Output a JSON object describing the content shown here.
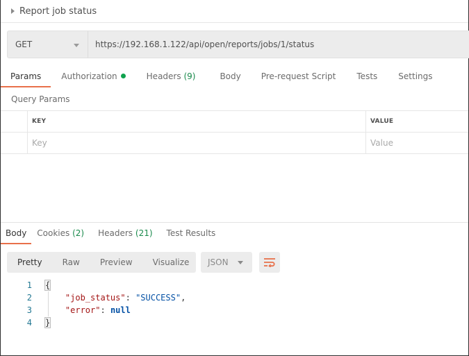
{
  "request": {
    "title": "Report job status",
    "method": "GET",
    "url": "https://192.168.1.122/api/open/reports/jobs/1/status"
  },
  "request_tabs": [
    {
      "label": "Params",
      "active": true
    },
    {
      "label": "Authorization",
      "indicator": "green-dot"
    },
    {
      "label": "Headers",
      "count": "(9)"
    },
    {
      "label": "Body"
    },
    {
      "label": "Pre-request Script"
    },
    {
      "label": "Tests"
    },
    {
      "label": "Settings"
    }
  ],
  "params": {
    "section_label": "Query Params",
    "columns": {
      "key": "KEY",
      "value": "VALUE"
    },
    "placeholders": {
      "key": "Key",
      "value": "Value"
    }
  },
  "response_tabs": [
    {
      "label": "Body",
      "active": true
    },
    {
      "label": "Cookies",
      "count": "(2)"
    },
    {
      "label": "Headers",
      "count": "(21)"
    },
    {
      "label": "Test Results"
    }
  ],
  "view_modes": [
    {
      "label": "Pretty",
      "active": true
    },
    {
      "label": "Raw"
    },
    {
      "label": "Preview"
    },
    {
      "label": "Visualize"
    }
  ],
  "format": {
    "selected": "JSON"
  },
  "icons": {
    "wrap": "wrap-lines-icon",
    "expand": "caret-right-icon",
    "dropdown": "chevron-down-icon"
  },
  "colors": {
    "accent": "#e8704a",
    "success": "#0fa24e",
    "count": "#1a8a4c"
  },
  "response_body": {
    "lines": [
      {
        "num": "1",
        "open": "{"
      },
      {
        "num": "2",
        "key": "\"job_status\"",
        "sep": ": ",
        "value": "\"SUCCESS\"",
        "trail": ","
      },
      {
        "num": "3",
        "key": "\"error\"",
        "sep": ": ",
        "value": "null",
        "trail": ""
      },
      {
        "num": "4",
        "close": "}"
      }
    ]
  }
}
